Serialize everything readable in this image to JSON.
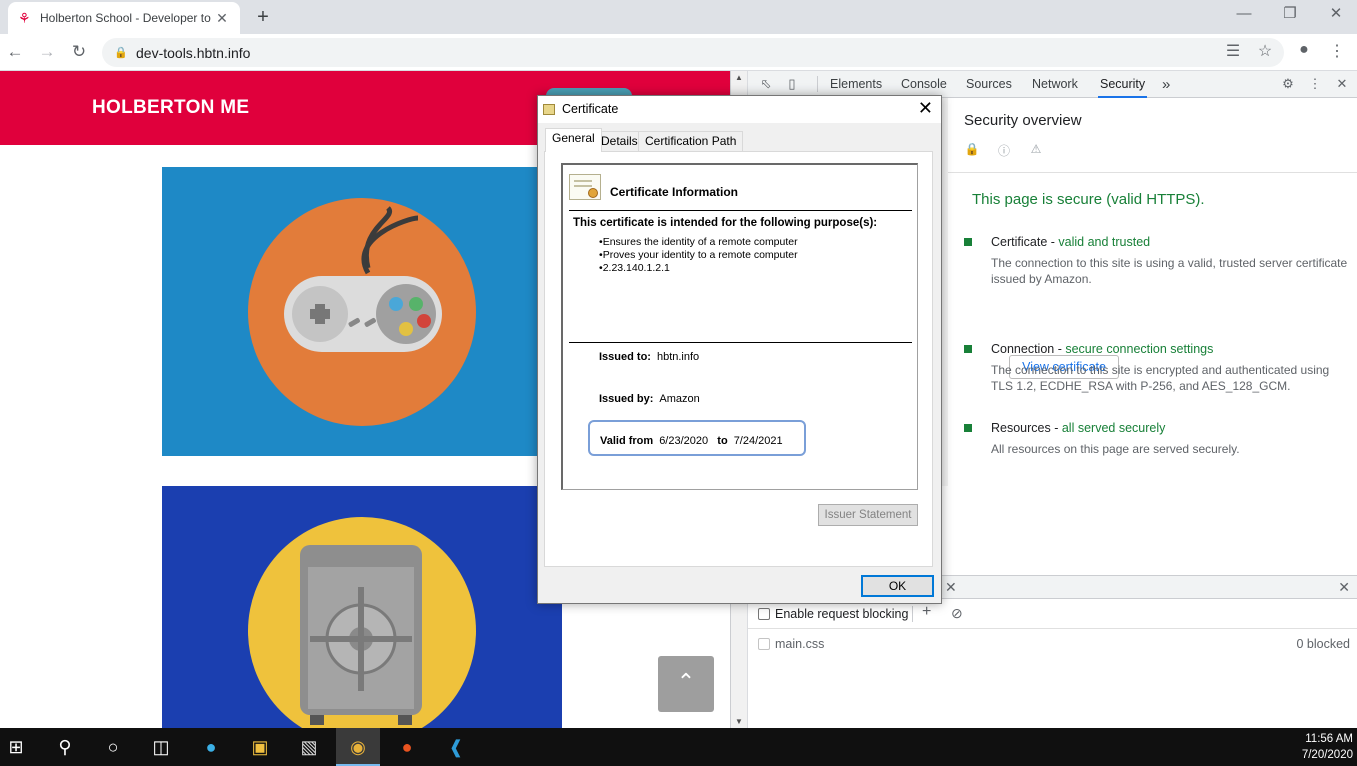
{
  "browser": {
    "tab_title": "Holberton School - Developer to",
    "url": "dev-tools.hbtn.info",
    "new_tab_symbol": "+",
    "close_symbol": "✕"
  },
  "page": {
    "brand": "HOLBERTON ME",
    "colors": {
      "header": "#e0003c",
      "card1": "#1e89c6",
      "card2": "#1b3fb0",
      "circle1": "#e27c3a",
      "circle2": "#efc23c"
    },
    "card_art": [
      "game-controller-illustration",
      "safe-illustration"
    ],
    "scroll_top_icon": "chevron-up-icon"
  },
  "devtools": {
    "tabs": [
      "Elements",
      "Console",
      "Sources",
      "Network",
      "Security"
    ],
    "active_tab": "Security",
    "more_tabs": "»",
    "security": {
      "title": "Security overview",
      "summary": "This page is secure (valid HTTPS).",
      "items": [
        {
          "label": "Certificate",
          "status": "valid and trusted",
          "desc": "The connection to this site is using a valid, trusted server certificate issued by Amazon."
        },
        {
          "label": "Connection",
          "status": "secure connection settings",
          "desc": "The connection to this site is encrypted and authenticated using TLS 1.2, ECDHE_RSA with P-256, and AES_128_GCM."
        },
        {
          "label": "Resources",
          "status": "all served securely",
          "desc": "All resources on this page are served securely."
        }
      ],
      "view_certificate": "View certificate",
      "separator": " - "
    },
    "drawer": {
      "enable_blocking": "Enable request blocking",
      "file": "main.css",
      "blocked": "0 blocked"
    }
  },
  "certificate": {
    "window_title": "Certificate",
    "tabs": [
      "General",
      "Details",
      "Certification Path"
    ],
    "info_title": "Certificate Information",
    "purpose_heading": "This certificate is intended for the following purpose(s):",
    "purposes": [
      "Ensures the identity of a remote computer",
      "Proves your identity to a remote computer",
      "2.23.140.1.2.1"
    ],
    "issued_to_label": "Issued to:",
    "issued_to": "hbtn.info",
    "issued_by_label": "Issued by:",
    "issued_by": "Amazon",
    "valid_from_label": "Valid from",
    "valid_from": "6/23/2020",
    "to_label": "to",
    "valid_to": "7/24/2021",
    "issuer_statement": "Issuer Statement",
    "ok": "OK"
  },
  "taskbar": {
    "time": "11:56 AM",
    "date": "7/20/2020",
    "apps": [
      "start-icon",
      "search-icon",
      "cortana-icon",
      "task-view-icon",
      "edge-icon",
      "file-explorer-icon",
      "store-icon",
      "chrome-icon",
      "ubuntu-icon",
      "vscode-icon"
    ]
  }
}
